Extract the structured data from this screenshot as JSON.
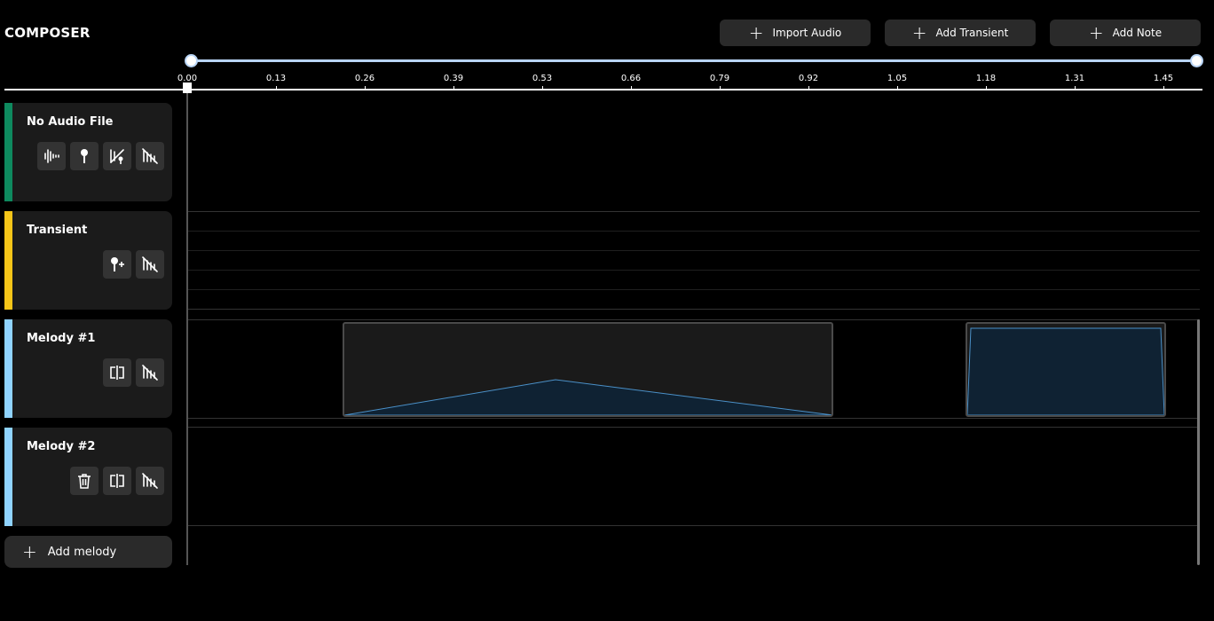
{
  "app": {
    "title": "COMPOSER"
  },
  "toolbar": {
    "import_audio": "Import Audio",
    "add_transient": "Add Transient",
    "add_note": "Add Note"
  },
  "timeline": {
    "ticks": [
      "0.00",
      "0.13",
      "0.26",
      "0.39",
      "0.53",
      "0.66",
      "0.79",
      "0.92",
      "1.05",
      "1.18",
      "1.31",
      "1.45"
    ]
  },
  "tracks": {
    "audio": {
      "name": "No Audio File",
      "color": "#0e8a5f"
    },
    "transient": {
      "name": "Transient",
      "color": "#f5c518"
    },
    "melody1": {
      "name": "Melody #1",
      "color": "#8fd3ff"
    },
    "melody2": {
      "name": "Melody #2",
      "color": "#8fd3ff"
    }
  },
  "add_melody_label": "Add melody",
  "colors": {
    "accent": "#b8d4f5",
    "note_fill": "#0f2233",
    "note_line": "#4a90c8"
  }
}
